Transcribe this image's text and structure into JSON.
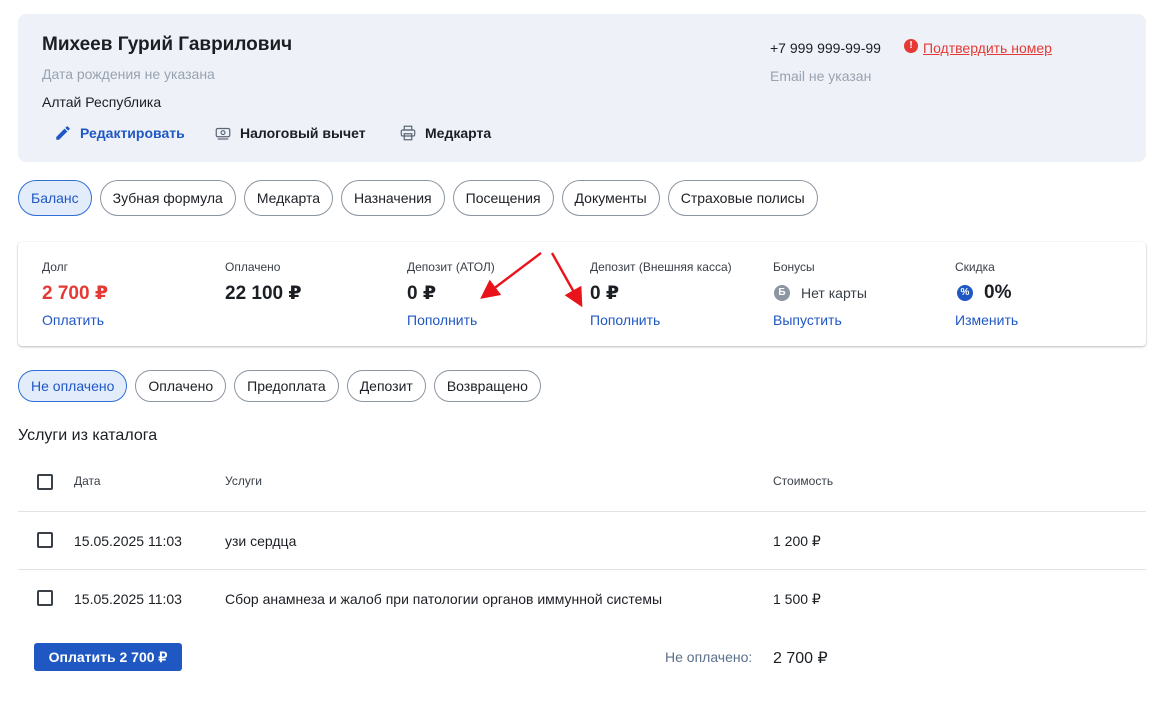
{
  "patient": {
    "name": "Михеев Гурий Гаврилович",
    "birth_date": "Дата рождения не указана",
    "region": "Алтай Республика",
    "phone": "+7 999 999-99-99",
    "confirm_phone_label": "Подтвердить номер",
    "email": "Email не указан",
    "actions": {
      "edit": "Редактировать",
      "tax": "Налоговый вычет",
      "medcard": "Медкарта"
    }
  },
  "tabs": [
    {
      "label": "Баланс",
      "active": true
    },
    {
      "label": "Зубная формула"
    },
    {
      "label": "Медкарта"
    },
    {
      "label": "Назначения"
    },
    {
      "label": "Посещения"
    },
    {
      "label": "Документы"
    },
    {
      "label": "Страховые полисы"
    }
  ],
  "balance": {
    "debt": {
      "label": "Долг",
      "value": "2 700 ₽",
      "link": "Оплатить"
    },
    "paid": {
      "label": "Оплачено",
      "value": "22 100 ₽"
    },
    "deposit_atol": {
      "label": "Депозит (АТОЛ)",
      "value": "0 ₽",
      "link": "Пополнить"
    },
    "deposit_ext": {
      "label": "Депозит (Внешняя касса)",
      "value": "0 ₽",
      "link": "Пополнить"
    },
    "bonuses": {
      "label": "Бонусы",
      "icon_glyph": "Б",
      "value": "Нет карты",
      "link": "Выпустить"
    },
    "discount": {
      "label": "Скидка",
      "icon_glyph": "%",
      "value": "0%",
      "link": "Изменить"
    }
  },
  "filters": [
    {
      "label": "Не оплачено",
      "active": true
    },
    {
      "label": "Оплачено"
    },
    {
      "label": "Предоплата"
    },
    {
      "label": "Депозит"
    },
    {
      "label": "Возвращено"
    }
  ],
  "services": {
    "title": "Услуги из каталога",
    "columns": {
      "date": "Дата",
      "service": "Услуги",
      "cost": "Стоимость"
    },
    "rows": [
      {
        "date": "15.05.2025 11:03",
        "service": "узи сердца",
        "cost": "1 200 ₽"
      },
      {
        "date": "15.05.2025 11:03",
        "service": "Сбор анамнеза и жалоб при патологии органов иммунной системы",
        "cost": "1 500 ₽"
      }
    ]
  },
  "footer": {
    "pay_button": "Оплатить 2 700 ₽",
    "unpaid_label": "Не оплачено:",
    "unpaid_value": "2 700 ₽"
  },
  "colors": {
    "accent": "#1f57c3",
    "danger": "#e53935",
    "card_bg": "#eef2f8",
    "annotation": "#e8131b"
  },
  "icons": {
    "edit": "pencil-icon",
    "tax": "money-icon",
    "medcard": "printer-icon",
    "warning": "alert-icon",
    "bonus": "bonus-icon",
    "discount": "percent-icon"
  }
}
